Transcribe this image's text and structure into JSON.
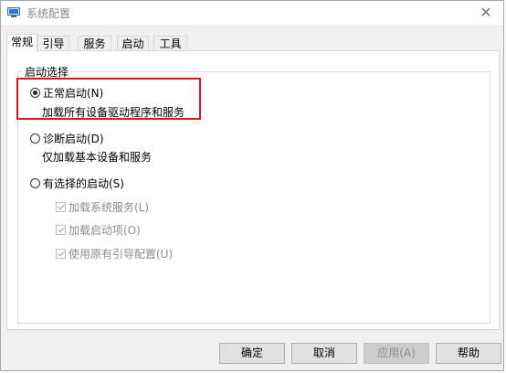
{
  "window": {
    "title": "系统配置"
  },
  "tabs": [
    "常规",
    "引导",
    "服务",
    "启动",
    "工具"
  ],
  "group": {
    "label": "启动选择"
  },
  "options": [
    {
      "label": "正常启动(N)",
      "desc": "加载所有设备驱动程序和服务",
      "checked": true
    },
    {
      "label": "诊断启动(D)",
      "desc": "仅加载基本设备和服务",
      "checked": false
    },
    {
      "label": "有选择的启动(S)",
      "desc": "",
      "checked": false
    }
  ],
  "selective_items": [
    {
      "label": "加载系统服务(L)",
      "checked": true
    },
    {
      "label": "加载启动项(O)",
      "checked": true
    },
    {
      "label": "使用原有引导配置(U)",
      "checked": true
    }
  ],
  "buttons": {
    "ok": "确定",
    "cancel": "取消",
    "apply": "应用(A)",
    "help": "帮助"
  },
  "colors": {
    "highlight": "#e0141e"
  }
}
